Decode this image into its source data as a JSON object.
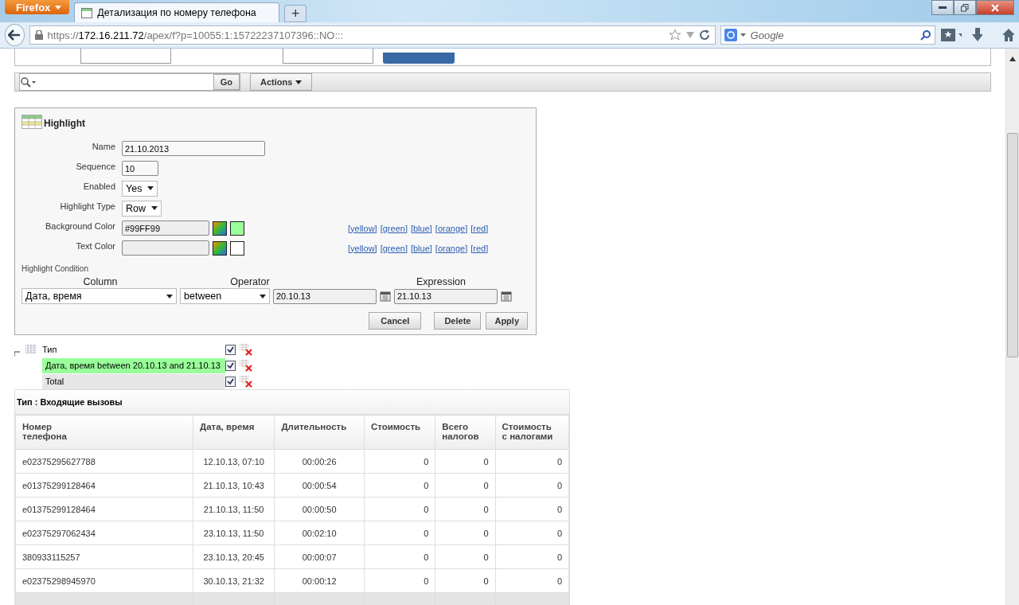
{
  "browser": {
    "menu_button": "Firefox",
    "tab": {
      "title": "Детализация по номеру телефона",
      "selected": true
    },
    "new_tab": "+",
    "url": {
      "scheme": "https://",
      "host": "172.16.211.72",
      "path": "/apex/f?p=10055:1:15722237107396::NO:::"
    },
    "search": {
      "placeholder": "Google"
    }
  },
  "toolbar": {
    "go": "Go",
    "actions": "Actions"
  },
  "highlight": {
    "title": "Highlight",
    "fields": [
      {
        "kind": "text",
        "label": "Name",
        "value": "21.10.2013"
      },
      {
        "kind": "short",
        "label": "Sequence",
        "value": "10"
      },
      {
        "kind": "select",
        "label": "Enabled",
        "value": "Yes"
      },
      {
        "kind": "select",
        "label": "Highlight Type",
        "value": "Row"
      },
      {
        "kind": "color",
        "label": "Background Color",
        "value": "#99FF99",
        "color": "#99ff99",
        "links": [
          "[yellow]",
          "[green]",
          "[blue]",
          "[orange]",
          "[red]"
        ]
      },
      {
        "kind": "color",
        "label": "Text Color",
        "color": "#ffffff",
        "links": [
          "[yellow]",
          "[green]",
          "[blue]",
          "[orange]",
          "[red]"
        ]
      }
    ],
    "condition": {
      "label": "Highlight Condition",
      "headers": [
        "Column",
        "Operator",
        "Expression"
      ],
      "column": "Дата, время",
      "operator": "between",
      "expression_1": "20.10.13",
      "expression_2": "21.10.13"
    },
    "buttons": [
      "Cancel",
      "Delete",
      "Apply"
    ]
  },
  "filters": {
    "expanded": true,
    "label": "Тип",
    "checked": true,
    "items": [
      {
        "label": "Дата, время between 20.10.13 and 21.10.13",
        "checked": true,
        "color": "#99ff99"
      },
      {
        "label": "Total",
        "checked": true,
        "color": "#e6e6e6"
      }
    ]
  },
  "report": {
    "group": "Тип : Входящие вызовы",
    "columns": [
      "Номер\nтелефона",
      "Дата, время",
      "Длительность",
      "Стоимость",
      "Всего\nналогов",
      "Стоимость\nс налогами"
    ],
    "rows": [
      [
        "e02375295627788",
        "12.10.13, 07:10",
        "00:00:26",
        "0",
        "0",
        "0"
      ],
      [
        "e01375299128464",
        "21.10.13, 10:43",
        "00:00:54",
        "0",
        "0",
        "0"
      ],
      [
        "e01375299128464",
        "21.10.13, 11:50",
        "00:00:50",
        "0",
        "0",
        "0"
      ],
      [
        "e02375297062434",
        "23.10.13, 11:50",
        "00:02:10",
        "0",
        "0",
        "0"
      ],
      [
        "380933115257",
        "23.10.13, 20:45",
        "00:00:07",
        "0",
        "0",
        "0"
      ],
      [
        "e02375298945970",
        "30.10.13, 21:32",
        "00:00:12",
        "0",
        "0",
        "0"
      ]
    ]
  }
}
